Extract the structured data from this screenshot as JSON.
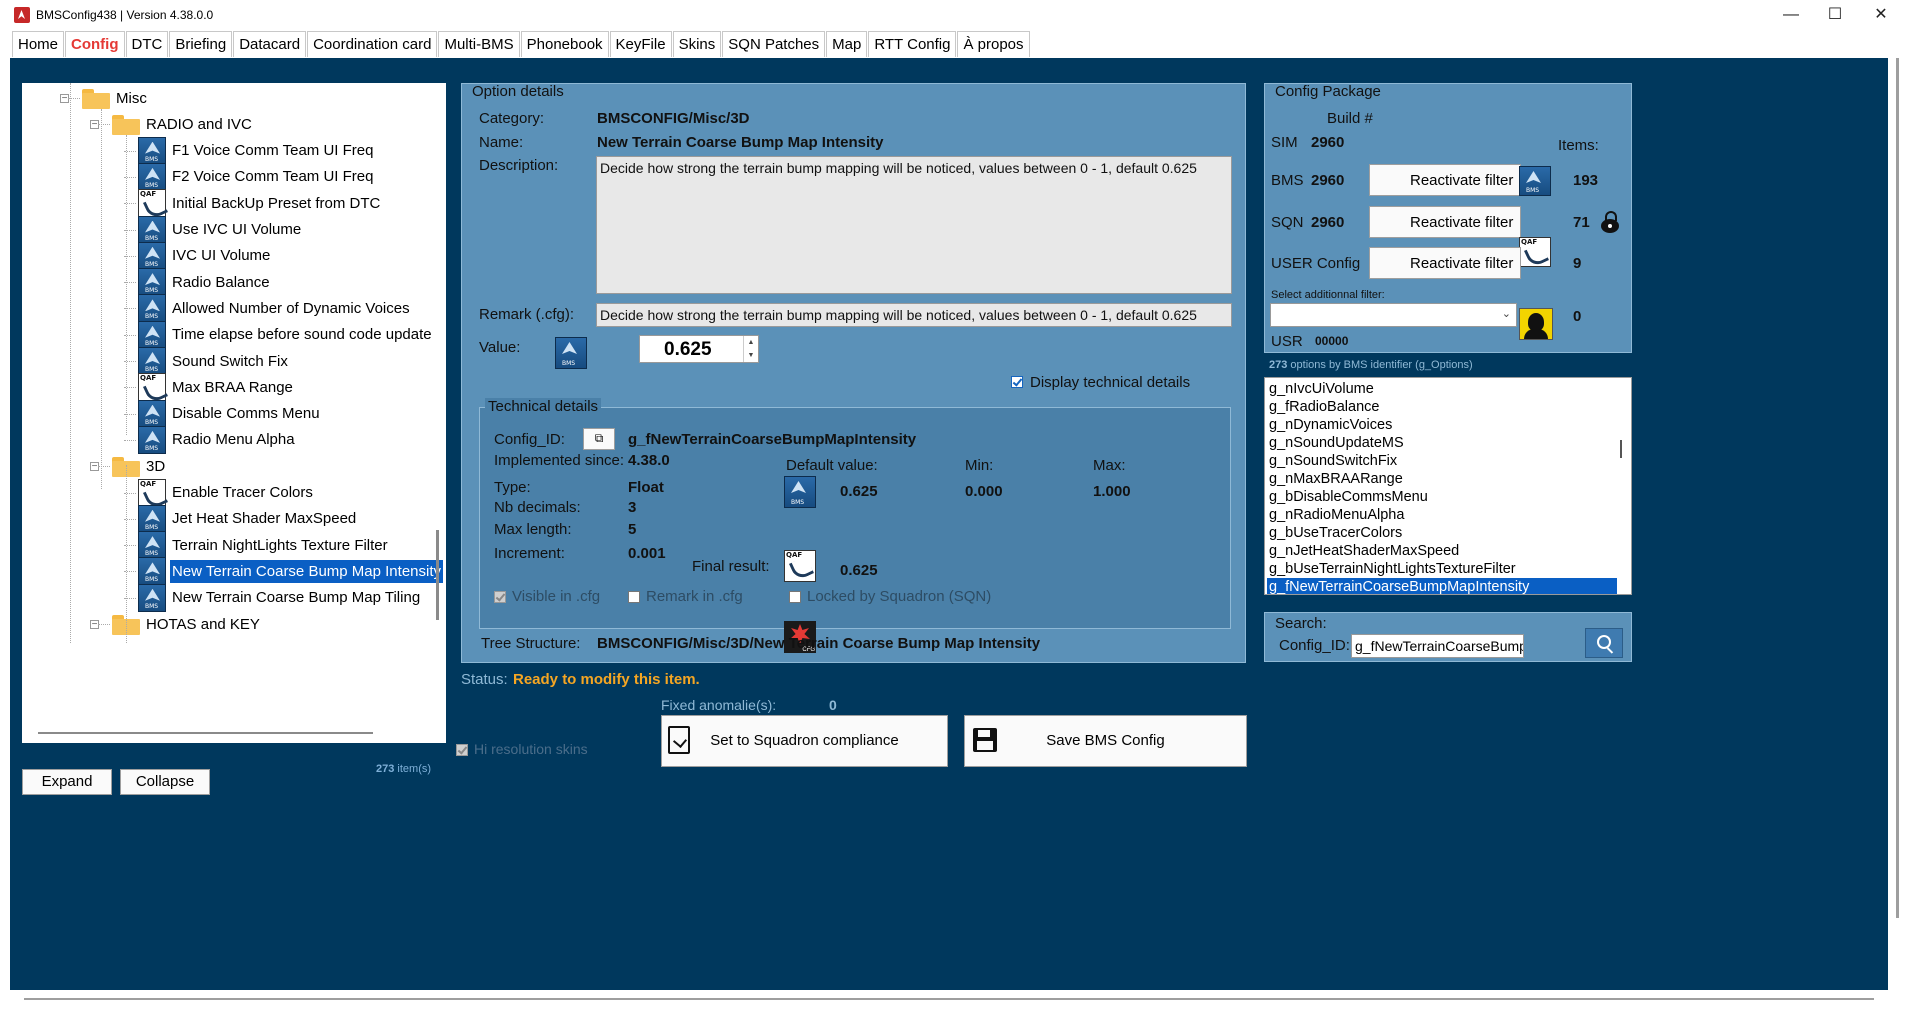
{
  "window": {
    "title": "BMSConfig438 | Version 4.38.0.0"
  },
  "tabs": [
    "Home",
    "Config",
    "DTC",
    "Briefing",
    "Datacard",
    "Coordination card",
    "Multi-BMS",
    "Phonebook",
    "KeyFile",
    "Skins",
    "SQN Patches",
    "Map",
    "RTT Config",
    "À propos"
  ],
  "active_tab": "Config",
  "tree": {
    "nodes": [
      {
        "label": "Misc",
        "icon": "folder-icon",
        "level": 0
      },
      {
        "label": "RADIO and IVC",
        "icon": "folder-icon",
        "level": 1
      },
      {
        "label": "F1 Voice Comm Team UI Freq",
        "icon": "bms-icon",
        "level": 2
      },
      {
        "label": "F2 Voice Comm Team UI Freq",
        "icon": "bms-icon",
        "level": 2
      },
      {
        "label": "Initial BackUp Preset from DTC",
        "icon": "qaf-icon",
        "level": 2
      },
      {
        "label": "Use IVC UI Volume",
        "icon": "bms-icon",
        "level": 2
      },
      {
        "label": "IVC UI Volume",
        "icon": "bms-icon",
        "level": 2
      },
      {
        "label": "Radio Balance",
        "icon": "bms-icon",
        "level": 2
      },
      {
        "label": "Allowed Number of Dynamic Voices",
        "icon": "bms-icon",
        "level": 2
      },
      {
        "label": "Time elapse before sound code update",
        "icon": "bms-icon",
        "level": 2
      },
      {
        "label": "Sound Switch Fix",
        "icon": "bms-icon",
        "level": 2
      },
      {
        "label": "Max BRAA Range",
        "icon": "qaf-icon",
        "level": 2
      },
      {
        "label": "Disable Comms Menu",
        "icon": "bms-icon",
        "level": 2
      },
      {
        "label": "Radio Menu Alpha",
        "icon": "bms-icon",
        "level": 2
      },
      {
        "label": "3D",
        "icon": "folder-icon",
        "level": 1
      },
      {
        "label": "Enable Tracer Colors",
        "icon": "qaf-icon",
        "level": 2
      },
      {
        "label": "Jet Heat Shader MaxSpeed",
        "icon": "bms-icon",
        "level": 2
      },
      {
        "label": "Terrain NightLights Texture Filter",
        "icon": "bms-icon",
        "level": 2
      },
      {
        "label": "New Terrain Coarse Bump Map Intensity",
        "icon": "bms-icon",
        "level": 2,
        "selected": true
      },
      {
        "label": "New Terrain Coarse Bump Map Tiling",
        "icon": "bms-icon",
        "level": 2
      },
      {
        "label": "HOTAS and KEY",
        "icon": "folder-icon",
        "level": 1
      }
    ],
    "expand_label": "Expand",
    "collapse_label": "Collapse",
    "count_text": "273",
    "count_suffix": "item(s)"
  },
  "option_details": {
    "title": "Option details",
    "category_label": "Category:",
    "category": "BMSCONFIG/Misc/3D",
    "name_label": "Name:",
    "name": "New Terrain Coarse Bump Map Intensity",
    "description_label": "Description:",
    "description": "Decide how strong the terrain bump mapping will be noticed, values between 0 - 1, default 0.625",
    "remark_label": "Remark (.cfg):",
    "remark": "Decide how strong the terrain bump mapping will be noticed, values between 0 - 1, default 0.625",
    "value_label": "Value:",
    "value": "0.625",
    "display_technical_label": "Display technical details",
    "technical": {
      "title": "Technical details",
      "config_id_label": "Config_ID:",
      "config_id": "g_fNewTerrainCoarseBumpMapIntensity",
      "implemented_label": "Implemented since:",
      "implemented": "4.38.0",
      "type_label": "Type:",
      "type": "Float",
      "nb_decimals_label": "Nb decimals:",
      "nb_decimals": "3",
      "max_length_label": "Max length:",
      "max_length": "5",
      "increment_label": "Increment:",
      "increment": "0.001",
      "default_label": "Default value:",
      "default": "0.625",
      "min_label": "Min:",
      "min": "0.000",
      "max_label": "Max:",
      "max": "1.000",
      "final_label": "Final result:",
      "final": "0.625",
      "visible_cfg_label": "Visible in .cfg",
      "remark_cfg_label": "Remark in .cfg",
      "locked_label": "Locked by Squadron (SQN)"
    },
    "tree_structure_label": "Tree Structure:",
    "tree_structure": "BMSCONFIG/Misc/3D/New Terrain Coarse Bump Map Intensity"
  },
  "status": {
    "label": "Status:",
    "text": "Ready to modify this item."
  },
  "fixed_anomalies": {
    "label": "Fixed anomalie(s):",
    "value": "0"
  },
  "hi_res_label": "Hi resolution skins",
  "actions": {
    "squadron_label": "Set to Squadron compliance",
    "save_label": "Save BMS Config"
  },
  "config_package": {
    "title": "Config Package",
    "build_label": "Build #",
    "items_label": "Items:",
    "sim_label": "SIM",
    "sim_build": "2960",
    "bms_label": "BMS",
    "bms_build": "2960",
    "bms_items": "193",
    "sqn_label": "SQN",
    "sqn_build": "2960",
    "sqn_items": "71",
    "user_label": "USER Config",
    "user_items": "9",
    "reactivate_label": "Reactivate filter",
    "additional_filter_label": "Select additionnal filter:",
    "additional_items": "0",
    "usr_label": "USR",
    "usr_value": "00000"
  },
  "id_list": {
    "count": "273",
    "caption": "options by BMS identifier (g_Options)",
    "items": [
      "g_nIvcUiVolume",
      "g_fRadioBalance",
      "g_nDynamicVoices",
      "g_nSoundUpdateMS",
      "g_nSoundSwitchFix",
      "g_nMaxBRAARange",
      "g_bDisableCommsMenu",
      "g_nRadioMenuAlpha",
      "g_bUseTracerColors",
      "g_nJetHeatShaderMaxSpeed",
      "g_bUseTerrainNightLightsTextureFilter",
      "g_fNewTerrainCoarseBumpMapIntensity"
    ],
    "selected_index": 11
  },
  "search": {
    "title": "Search:",
    "config_id_label": "Config_ID:",
    "value": "g_fNewTerrainCoarseBumpMapInt"
  },
  "colors": {
    "background": "#00385d",
    "panel": "#5b91b8",
    "selection": "#0a5fc4",
    "status": "#f5a623",
    "active_tab": "#e53935"
  }
}
